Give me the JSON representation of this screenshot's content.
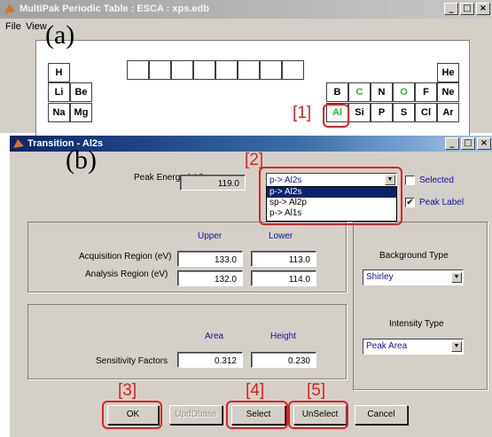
{
  "back_window": {
    "title": "MultiPak Periodic Table : ESCA : xps.edb",
    "menu": [
      "File",
      "View"
    ],
    "elements": {
      "row1": [
        "H",
        "He"
      ],
      "row2": [
        "Li",
        "Be",
        "B",
        "C",
        "N",
        "O",
        "F",
        "Ne"
      ],
      "row3": [
        "Na",
        "Mg",
        "Al",
        "Si",
        "P",
        "S",
        "Cl",
        "Ar"
      ]
    }
  },
  "front_window": {
    "title": "Transition - Al2s",
    "peak_energy_label": "Peak Energy (eV)",
    "peak_energy_value": "119.0",
    "transition_combo": {
      "selected": "p-> Al2s",
      "options": [
        "p-> Al2s",
        "sp-> Al2p",
        "p-> Al1s"
      ]
    },
    "selected_checkbox": {
      "label": "Selected",
      "checked": false
    },
    "peak_label_checkbox": {
      "label": "Peak Label",
      "checked": true
    },
    "region_panel": {
      "upper_header": "Upper",
      "lower_header": "Lower",
      "acquisition_label": "Acquisition Region (eV)",
      "acquisition_upper": "133.0",
      "acquisition_lower": "113.0",
      "analysis_label": "Analysis Region (eV)",
      "analysis_upper": "132.0",
      "analysis_lower": "114.0"
    },
    "sensitivity_panel": {
      "area_header": "Area",
      "height_header": "Height",
      "label": "Sensitivity Factors",
      "area_value": "0.312",
      "height_value": "0.230"
    },
    "right_panel": {
      "background_type_label": "Background Type",
      "background_type_value": "Shirley",
      "intensity_type_label": "Intensity Type",
      "intensity_type_value": "Peak Area"
    },
    "buttons": {
      "ok": "OK",
      "updatedbase": "UpdDbase",
      "select": "Select",
      "unselect": "UnSelect",
      "cancel": "Cancel"
    }
  },
  "annotations": {
    "a": "(a)",
    "b": "(b)",
    "n1": "[1]",
    "n2": "[2]",
    "n3": "[3]",
    "n4": "[4]",
    "n5": "[5]"
  },
  "window_controls": {
    "minimize": "_",
    "maximize": "□",
    "close": "×"
  },
  "colors": {
    "annotation_red": "#e02020",
    "element_green": "#25b825",
    "active_title": "#0a246a"
  }
}
